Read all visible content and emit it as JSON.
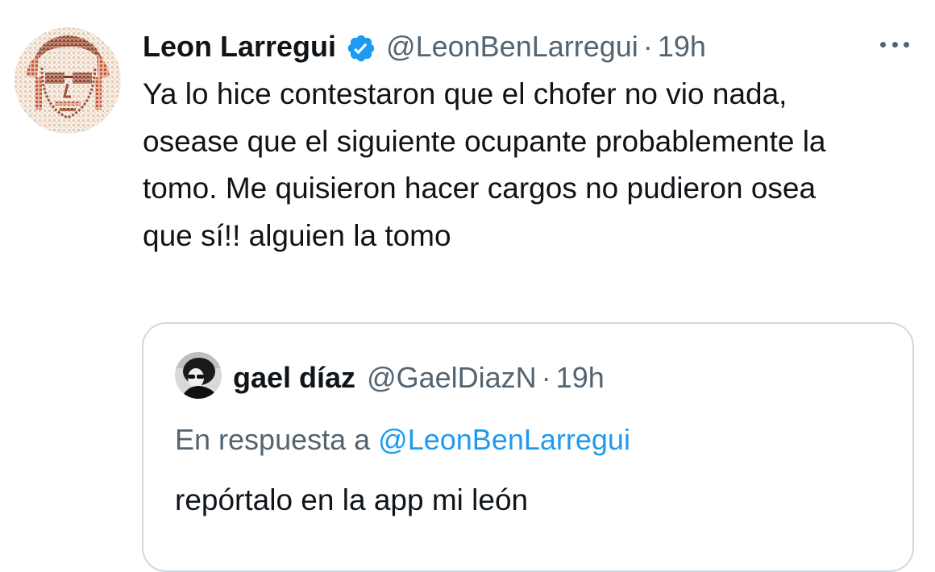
{
  "tweet": {
    "author": {
      "display_name": "Leon Larregui",
      "handle": "@LeonBenLarregui",
      "verified_icon": "verified-badge-icon",
      "avatar": "sketch-portrait-avatar"
    },
    "separator": "·",
    "time": "19h",
    "more_icon": "more-options-icon",
    "text": "Ya lo hice contestaron que el chofer no vio nada, oseasе que el siguiente ocupante probablemente la tomo. Me quisieron hacer cargos no pudieron osea que sí!! alguien la tomo"
  },
  "quoted": {
    "author": {
      "display_name": "gael díaz",
      "handle": "@GaelDiazN",
      "avatar": "bw-photo-avatar"
    },
    "separator": "·",
    "time": "19h",
    "reply_prefix": "En respuesta a",
    "reply_handle": "@LeonBenLarregui",
    "text": "repórtalo en la app mi león"
  },
  "colors": {
    "text": "#0f1419",
    "secondary": "#536471",
    "accent": "#1d9bf0",
    "border": "#cfd9de"
  }
}
